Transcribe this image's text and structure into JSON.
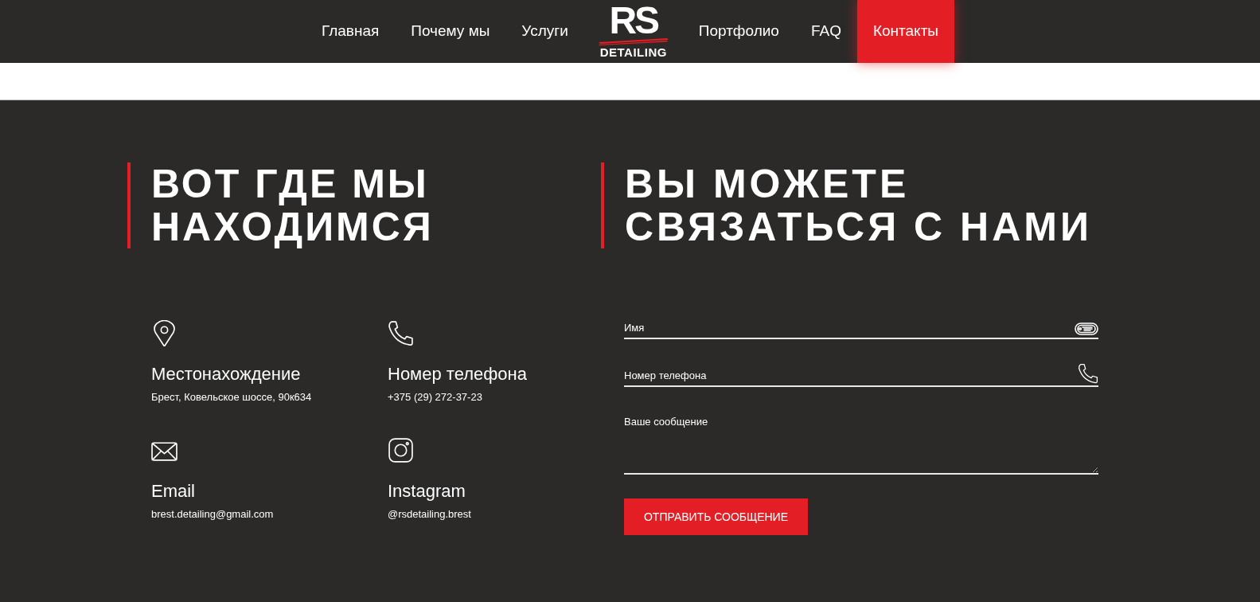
{
  "nav": {
    "items_left": [
      {
        "label": "Главная",
        "selected": false
      },
      {
        "label": "Почему мы",
        "selected": false
      },
      {
        "label": "Услуги",
        "selected": false
      }
    ],
    "logo": {
      "mark": "RS",
      "sub": "DETAILING"
    },
    "items_right": [
      {
        "label": "Портфолио",
        "selected": false
      },
      {
        "label": "FAQ",
        "selected": false
      },
      {
        "label": "Контакты",
        "selected": true
      }
    ]
  },
  "location_section": {
    "heading": "ВОТ ГДЕ МЫ НАХОДИМСЯ",
    "cards": [
      {
        "kind": "location",
        "title": "Местонахождение",
        "text": "Брест, Ковельское шоссе, 90к634"
      },
      {
        "kind": "phone",
        "title": "Номер телефона",
        "text": "+375 (29) 272-37-23"
      },
      {
        "kind": "email",
        "title": "Email",
        "text": "brest.detailing@gmail.com"
      },
      {
        "kind": "instagram",
        "title": "Instagram",
        "text": "@rsdetailing.brest"
      }
    ]
  },
  "contact_form": {
    "heading": "ВЫ МОЖЕТЕ СВЯЗАТЬСЯ С НАМИ",
    "fields": [
      {
        "kind": "name",
        "placeholder": "Имя"
      },
      {
        "kind": "phone",
        "placeholder": "Номер телефона"
      },
      {
        "kind": "message",
        "placeholder": "Ваше сообщение"
      }
    ],
    "submit": "ОТПРАВИТЬ СООБЩЕНИЕ"
  }
}
